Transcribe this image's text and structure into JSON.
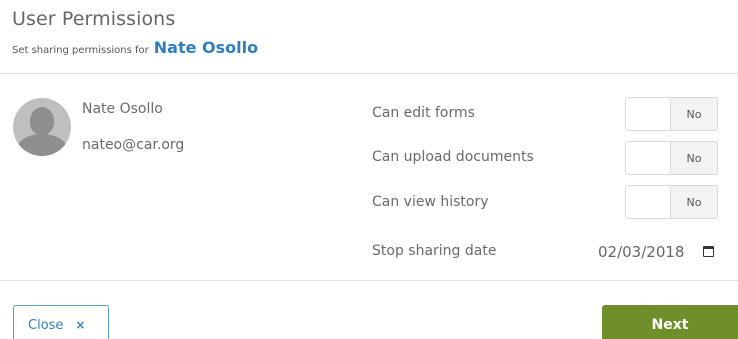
{
  "header": {
    "title": "User Permissions",
    "subtitle_prefix": "Set sharing permissions for",
    "user_name": "Nate Osollo"
  },
  "user": {
    "name": "Nate Osollo",
    "email": "nateo@car.org"
  },
  "permissions": [
    {
      "label": "Can edit forms",
      "value": "No"
    },
    {
      "label": "Can upload documents",
      "value": "No"
    },
    {
      "label": "Can view history",
      "value": "No"
    }
  ],
  "stop_sharing": {
    "label": "Stop sharing date",
    "value": "02/03/2018"
  },
  "footer": {
    "close_label": "Close",
    "close_symbol": "×",
    "next_label": "Next"
  },
  "colors": {
    "accent_blue": "#2e7fc2",
    "next_green": "#6f8f2a"
  },
  "icons": {
    "avatar": "user-silhouette",
    "date": "calendar-icon",
    "close": "close-icon"
  }
}
